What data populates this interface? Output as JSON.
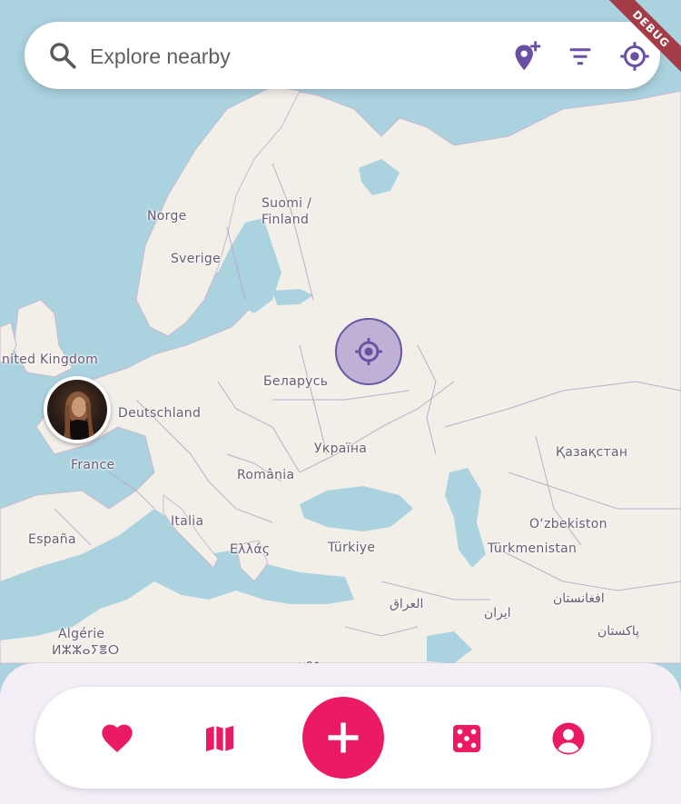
{
  "search": {
    "placeholder": "Explore nearby",
    "icon": "search-icon",
    "actions": [
      {
        "name": "add-location-button",
        "icon": "add-location-icon"
      },
      {
        "name": "filter-button",
        "icon": "filter-icon"
      },
      {
        "name": "my-location-button",
        "icon": "my-location-icon"
      }
    ]
  },
  "debug_banner": "DEBUG",
  "map": {
    "labels": [
      "Norge",
      "Sverige",
      "Suomi /",
      "Finland",
      "nited Kingdom",
      "Deutschland",
      "Беларусь",
      "France",
      "Україна",
      "Қазақстан",
      "România",
      "España",
      "Italia",
      "Ελλάς",
      "Türkiye",
      "O‘zbekiston",
      "Türkmenistan",
      "العراق",
      "ایران",
      "افغانستان",
      "Algérie",
      "ⵍⵣⵣⴰⵢⴻⵔ",
      "پاکستان",
      "مصر"
    ],
    "current_location_marker": "my-location-icon",
    "user_marker": "avatar"
  },
  "bottom_nav": {
    "items": [
      {
        "name": "favorites",
        "icon": "heart-icon"
      },
      {
        "name": "map",
        "icon": "map-icon"
      },
      {
        "name": "add",
        "icon": "plus-icon"
      },
      {
        "name": "random",
        "icon": "dice-icon"
      },
      {
        "name": "profile",
        "icon": "account-circle-icon"
      }
    ]
  },
  "colors": {
    "accent": "#ea1a64",
    "primary": "#6a4fa3",
    "water": "#aad3df",
    "land": "#f2efe9"
  }
}
